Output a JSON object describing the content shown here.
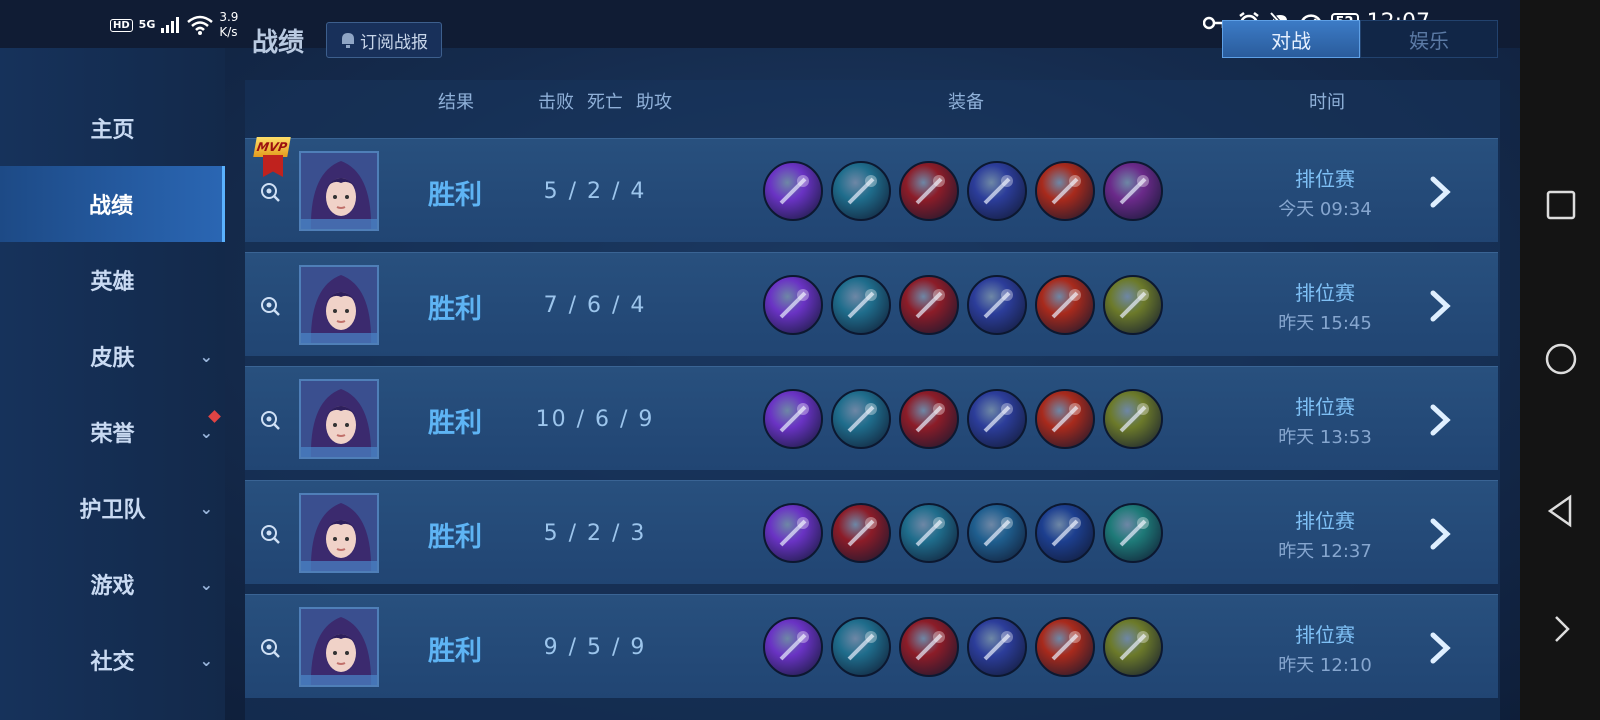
{
  "status_bar": {
    "hd": "HD",
    "network": "5G",
    "speed_value": "3.9",
    "speed_unit": "K/s",
    "battery": "52",
    "time": "12:07"
  },
  "header": {
    "title": "战绩",
    "subscribe_label": "订阅战报",
    "tabs": [
      {
        "label": "对战",
        "active": true
      },
      {
        "label": "娱乐",
        "active": false
      }
    ]
  },
  "sidebar": {
    "items": [
      {
        "label": "主页",
        "active": false,
        "expandable": false
      },
      {
        "label": "战绩",
        "active": true,
        "expandable": false
      },
      {
        "label": "英雄",
        "active": false,
        "expandable": false
      },
      {
        "label": "皮肤",
        "active": false,
        "expandable": true
      },
      {
        "label": "荣誉",
        "active": false,
        "expandable": true,
        "badge": true
      },
      {
        "label": "护卫队",
        "active": false,
        "expandable": true
      },
      {
        "label": "游戏",
        "active": false,
        "expandable": true
      },
      {
        "label": "社交",
        "active": false,
        "expandable": true
      }
    ]
  },
  "columns": {
    "result": "结果",
    "kills": "击败",
    "deaths": "死亡",
    "assists": "助攻",
    "equipment": "装备",
    "time": "时间"
  },
  "matches": [
    {
      "mvp": true,
      "mvp_label": "MVP",
      "result": "胜利",
      "kda": "5 / 2 / 4",
      "mode": "排位赛",
      "time": "今天 09:34",
      "items": [
        "dragon-item-icon",
        "boots-item-icon",
        "hat-item-icon",
        "scepter-item-icon",
        "staff-item-icon",
        "purple-rune-item-icon"
      ]
    },
    {
      "mvp": false,
      "result": "胜利",
      "kda": "7 / 6 / 4",
      "mode": "排位赛",
      "time": "昨天 15:45",
      "items": [
        "dragon-item-icon",
        "boots-item-icon",
        "hat-item-icon",
        "scepter-item-icon",
        "staff-item-icon",
        "book-item-icon"
      ]
    },
    {
      "mvp": false,
      "result": "胜利",
      "kda": "10 / 6 / 9",
      "mode": "排位赛",
      "time": "昨天 13:53",
      "items": [
        "dragon-item-icon",
        "boots-item-icon",
        "hat-item-icon",
        "scepter-item-icon",
        "staff-item-icon",
        "book-item-icon"
      ]
    },
    {
      "mvp": false,
      "result": "胜利",
      "kda": "5 / 2 / 3",
      "mode": "排位赛",
      "time": "昨天 12:37",
      "items": [
        "dragon-item-icon",
        "hat-item-icon",
        "boots-item-icon",
        "orb-item-icon",
        "crystal-item-icon",
        "wand-item-icon"
      ]
    },
    {
      "mvp": false,
      "result": "胜利",
      "kda": "9 / 5 / 9",
      "mode": "排位赛",
      "time": "昨天 12:10",
      "items": [
        "dragon-item-icon",
        "boots-item-icon",
        "hat-item-icon",
        "scepter-item-icon",
        "staff-item-icon",
        "book-item-icon"
      ]
    }
  ],
  "item_colors": {
    "dragon-item-icon": "#6a33c4",
    "boots-item-icon": "#1f6d8c",
    "hat-item-icon": "#8c1c28",
    "scepter-item-icon": "#2c3d9a",
    "staff-item-icon": "#a82a1c",
    "purple-rune-item-icon": "#6b2a8a",
    "book-item-icon": "#6c7a2a",
    "orb-item-icon": "#1f5e8e",
    "crystal-item-icon": "#1d3f8f",
    "wand-item-icon": "#1e7a78"
  }
}
